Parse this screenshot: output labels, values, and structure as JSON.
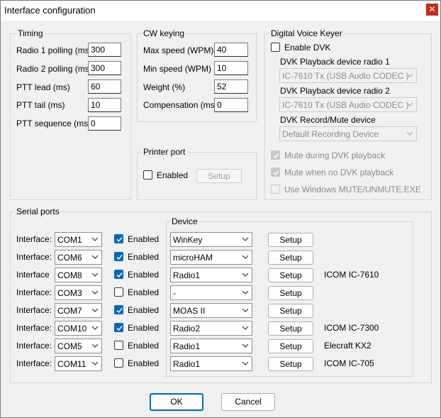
{
  "window": {
    "title": "Interface configuration",
    "close_glyph": "✕"
  },
  "timing": {
    "title": "Timing",
    "fields": [
      {
        "label": "Radio 1 polling (ms)",
        "value": "300"
      },
      {
        "label": "Radio 2 polling (ms)",
        "value": "300"
      },
      {
        "label": "PTT lead (ms)",
        "value": "60"
      },
      {
        "label": "PTT tail (ms)",
        "value": "10"
      },
      {
        "label": "PTT sequence (ms)",
        "value": "0"
      }
    ]
  },
  "cw": {
    "title": "CW keying",
    "fields": [
      {
        "label": "Max speed (WPM)",
        "value": "40"
      },
      {
        "label": "Min speed (WPM)",
        "value": "10"
      },
      {
        "label": "Weight (%)",
        "value": "52"
      },
      {
        "label": "Compensation (ms)",
        "value": "0"
      }
    ]
  },
  "printer": {
    "title": "Printer port",
    "enabled_label": "Enabled",
    "enabled": false,
    "setup_label": "Setup"
  },
  "dvk": {
    "title": "Digital Voice Keyer",
    "enable_label": "Enable DVK",
    "enable_checked": false,
    "playback1_label": "DVK Playback device radio 1",
    "playback1_value": "IC-7610 Tx (USB Audio CODEC )",
    "playback2_label": "DVK Playback device radio 2",
    "playback2_value": "IC-7610 Tx (USB Audio CODEC )",
    "record_label": "DVK Record/Mute device",
    "record_value": "Default Recording Device",
    "mute_during_label": "Mute during DVK playback",
    "mute_during_checked": true,
    "mute_no_label": "Mute when no DVK playback",
    "mute_no_checked": true,
    "windows_mute_label": "Use Windows MUTE/UNMUTE.EXE",
    "windows_mute_checked": false
  },
  "serial": {
    "title": "Serial ports",
    "device_title": "Device",
    "rows": [
      {
        "label": "Interface:",
        "port": "COM1",
        "enabled": true,
        "enabled_label": "Enabled",
        "device": "WinKey",
        "setup": "Setup",
        "note": ""
      },
      {
        "label": "Interface:",
        "port": "COM6",
        "enabled": true,
        "enabled_label": "Enabled",
        "device": "microHAM",
        "setup": "Setup",
        "note": ""
      },
      {
        "label": "Interface",
        "port": "COM8",
        "enabled": true,
        "enabled_label": "Enabled",
        "device": "Radio1",
        "setup": "Setup",
        "note": "ICOM IC-7610"
      },
      {
        "label": "Interface:",
        "port": "COM3",
        "enabled": false,
        "enabled_label": "Enabled",
        "device": "-",
        "setup": "Setup",
        "note": ""
      },
      {
        "label": "Interface:",
        "port": "COM7",
        "enabled": true,
        "enabled_label": "Enabled",
        "device": "MOAS II",
        "setup": "Setup",
        "note": ""
      },
      {
        "label": "Interface:",
        "port": "COM10",
        "enabled": true,
        "enabled_label": "Enabled",
        "device": "Radio2",
        "setup": "Setup",
        "note": "ICOM IC-7300"
      },
      {
        "label": "Interface:",
        "port": "COM5",
        "enabled": false,
        "enabled_label": "Enabled",
        "device": "Radio1",
        "setup": "Setup",
        "note": "Elecraft KX2"
      },
      {
        "label": "Interface:",
        "port": "COM11",
        "enabled": false,
        "enabled_label": "Enabled",
        "device": "Radio1",
        "setup": "Setup",
        "note": "ICOM IC-705"
      }
    ]
  },
  "buttons": {
    "ok": "OK",
    "cancel": "Cancel"
  }
}
